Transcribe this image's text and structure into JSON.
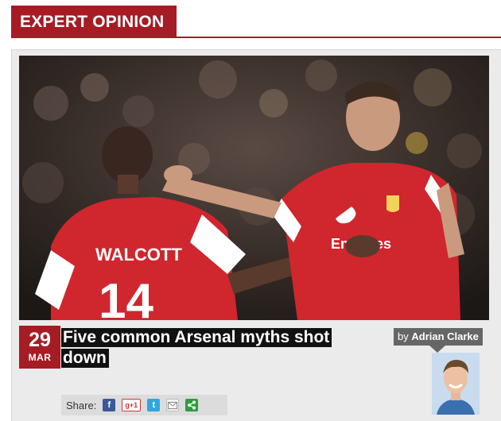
{
  "section": {
    "title": "EXPERT OPINION"
  },
  "article": {
    "date": {
      "day": "29",
      "month": "MAR"
    },
    "headline": "Five common Arsenal myths shot down",
    "byline": {
      "prefix": "by",
      "author": "Adrian Clarke"
    },
    "photo": {
      "shirt_name": "WALCOTT",
      "shirt_number": "14",
      "sponsor": "Emirates"
    }
  },
  "share": {
    "label": "Share:",
    "buttons": [
      {
        "icon": "facebook-icon",
        "text": "f"
      },
      {
        "icon": "google-plus-icon",
        "text": "g+1"
      },
      {
        "icon": "twitter-icon",
        "text": "t"
      },
      {
        "icon": "email-icon",
        "text": ""
      },
      {
        "icon": "share-icon",
        "text": ""
      }
    ]
  },
  "colors": {
    "brand": "#a51c24",
    "card": "#ebebeb",
    "byline": "#666666"
  }
}
